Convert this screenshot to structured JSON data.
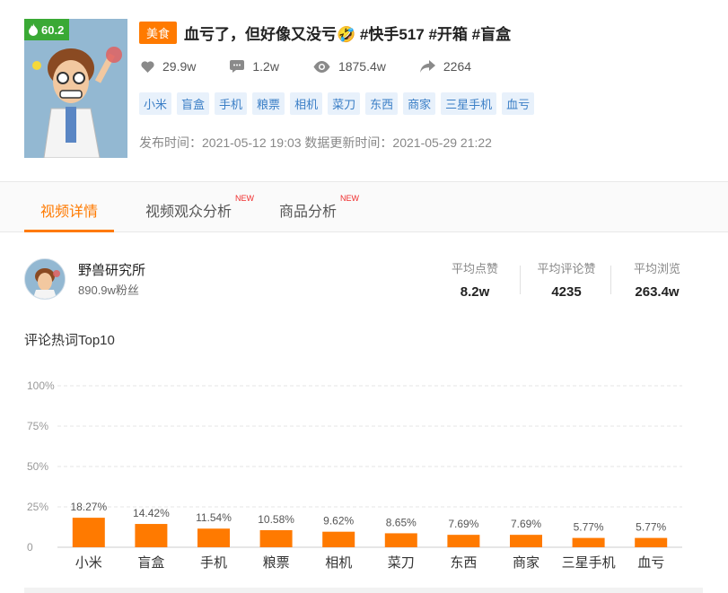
{
  "video": {
    "score": "60.2",
    "category": "美食",
    "title": "血亏了，但好像又没亏🤣 #快手517 #开箱 #盲盒",
    "likes": "29.9w",
    "comments": "1.2w",
    "views": "1875.4w",
    "shares": "2264",
    "keywords": [
      "小米",
      "盲盒",
      "手机",
      "粮票",
      "相机",
      "菜刀",
      "东西",
      "商家",
      "三星手机",
      "血亏"
    ],
    "time_info": "发布时间：2021-05-12 19:03 数据更新时间：2021-05-29 21:22"
  },
  "tabs": [
    {
      "label": "视频详情",
      "active": true,
      "new": ""
    },
    {
      "label": "视频观众分析",
      "active": false,
      "new": "NEW"
    },
    {
      "label": "商品分析",
      "active": false,
      "new": "NEW"
    }
  ],
  "author": {
    "name": "野兽研究所",
    "fans": "890.9w粉丝",
    "metrics": [
      {
        "label": "平均点赞",
        "value": "8.2w"
      },
      {
        "label": "平均评论赞",
        "value": "4235"
      },
      {
        "label": "平均浏览",
        "value": "263.4w"
      }
    ]
  },
  "colors": {
    "accent": "#ff7a00",
    "score_green": "#3aa935",
    "keyword_blue": "#3a7ec6"
  },
  "chart_title": "评论热词Top10",
  "chart_data": {
    "type": "bar",
    "categories": [
      "小米",
      "盲盒",
      "手机",
      "粮票",
      "相机",
      "菜刀",
      "东西",
      "商家",
      "三星手机",
      "血亏"
    ],
    "values": [
      18.27,
      14.42,
      11.54,
      10.58,
      9.62,
      8.65,
      7.69,
      7.69,
      5.77,
      5.77
    ],
    "value_labels": [
      "18.27%",
      "14.42%",
      "11.54%",
      "10.58%",
      "9.62%",
      "8.65%",
      "7.69%",
      "7.69%",
      "5.77%",
      "5.77%"
    ],
    "y_ticks": [
      "0",
      "25%",
      "50%",
      "75%",
      "100%"
    ],
    "ylim": [
      0,
      100
    ],
    "grid": true,
    "bar_color": "#ff7a00"
  }
}
